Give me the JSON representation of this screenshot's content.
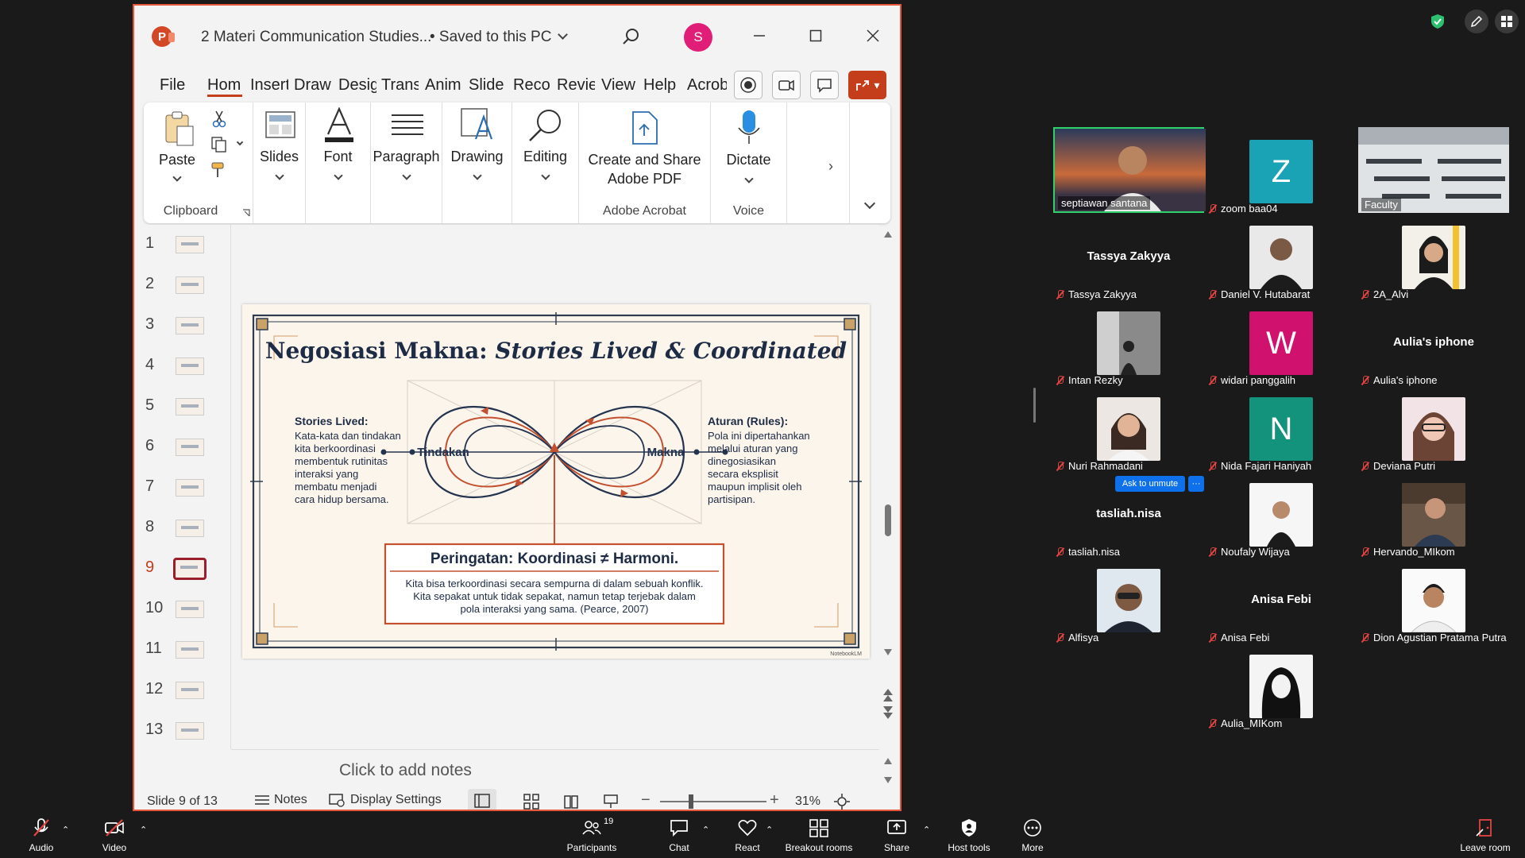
{
  "powerpoint": {
    "app_icon_letter": "P",
    "doc_title": "2 Materi Communication Studies...",
    "save_state": "• Saved to this PC",
    "user_initial": "S",
    "menu_tabs": [
      "File",
      "Hom",
      "Insert",
      "Draw",
      "Desig",
      "Trans",
      "Anim",
      "Slide",
      "Recor",
      "Revie",
      "View",
      "Help",
      "Acrob"
    ],
    "ribbon": {
      "paste": "Paste",
      "clipboard": "Clipboard",
      "slides": "Slides",
      "font": "Font",
      "paragraph": "Paragraph",
      "drawing": "Drawing",
      "editing": "Editing",
      "create_share_1": "Create and Share",
      "create_share_2": "Adobe PDF",
      "adobe_acrobat": "Adobe Acrobat",
      "dictate": "Dictate",
      "voice": "Voice"
    },
    "thumbnails": [
      "1",
      "2",
      "3",
      "4",
      "5",
      "6",
      "7",
      "8",
      "9",
      "10",
      "11",
      "12",
      "13"
    ],
    "active_slide": "9",
    "notes_placeholder": "Click to add notes",
    "status": {
      "slide_counter": "Slide 9 of 13",
      "notes": "Notes",
      "display_settings": "Display Settings",
      "zoom": "31%"
    }
  },
  "slide": {
    "title_plain": "Negosiasi Makna: ",
    "title_italic": "Stories Lived & Coordinated",
    "left_heading": "Stories Lived:",
    "left_body": [
      "Kata-kata dan tindakan",
      "kita berkoordinasi",
      "membentuk rutinitas",
      "interaksi yang",
      "membatu menjadi",
      "cara hidup bersama."
    ],
    "right_heading": "Aturan (Rules):",
    "right_body": [
      "Pola ini dipertahankan",
      "melalui aturan yang",
      "dinegosiasikan",
      "secara eksplisit",
      "maupun implisit oleh",
      "partisipan."
    ],
    "loop_left": "Tindakan",
    "loop_right": "Makna",
    "warning_title": "Peringatan: Koordinasi ≠ Harmoni.",
    "warning_body": [
      "Kita bisa terkoordinasi secara sempurna di dalam sebuah konflik.",
      "Kita sepakat untuk tidak sepakat, namun tetap terjebak dalam",
      "pola interaksi yang sama. (Pearce, 2007)"
    ],
    "watermark": "NotebookLM"
  },
  "zoom": {
    "participants": [
      {
        "name": "septiawan santana",
        "type": "photo",
        "active": true
      },
      {
        "name": "zoom baa04",
        "type": "letter",
        "letter": "Z",
        "color": "#1aa3b5"
      },
      {
        "name": "Faculty",
        "type": "photo"
      },
      {
        "name": "Tassya Zakyya",
        "type": "name",
        "big": "Tassya Zakyya"
      },
      {
        "name": "Daniel V. Hutabarat",
        "type": "photo"
      },
      {
        "name": "2A_Alvi",
        "type": "photo"
      },
      {
        "name": "Intan Rezky",
        "type": "photo"
      },
      {
        "name": "widari panggalih",
        "type": "letter",
        "letter": "W",
        "color": "#d0116e"
      },
      {
        "name": "Aulia's iphone",
        "type": "name",
        "big": "Aulia's iphone"
      },
      {
        "name": "Nuri Rahmadani",
        "type": "photo"
      },
      {
        "name": "Nida Fajari Haniyah",
        "type": "letter",
        "letter": "N",
        "color": "#13927c"
      },
      {
        "name": "Deviana Putri",
        "type": "photo"
      },
      {
        "name": "tasliah.nisa",
        "type": "name",
        "big": "tasliah.nisa"
      },
      {
        "name": "Noufaly Wijaya",
        "type": "photo"
      },
      {
        "name": "Hervando_MIkom",
        "type": "photo"
      },
      {
        "name": "Alfisya",
        "type": "photo"
      },
      {
        "name": "Anisa Febi",
        "type": "name",
        "big": "Anisa Febi"
      },
      {
        "name": "Dion Agustian Pratama Putra",
        "type": "photo"
      },
      {
        "name": "Aulia_MIKom",
        "type": "photo"
      }
    ],
    "ask_unmute": "Ask to unmute",
    "ask_more": "···",
    "toolbar": {
      "audio": "Audio",
      "video": "Video",
      "participants": "Participants",
      "participants_count": "19",
      "chat": "Chat",
      "react": "React",
      "breakout": "Breakout rooms",
      "share": "Share",
      "host_tools": "Host tools",
      "more": "More",
      "leave": "Leave room"
    }
  }
}
